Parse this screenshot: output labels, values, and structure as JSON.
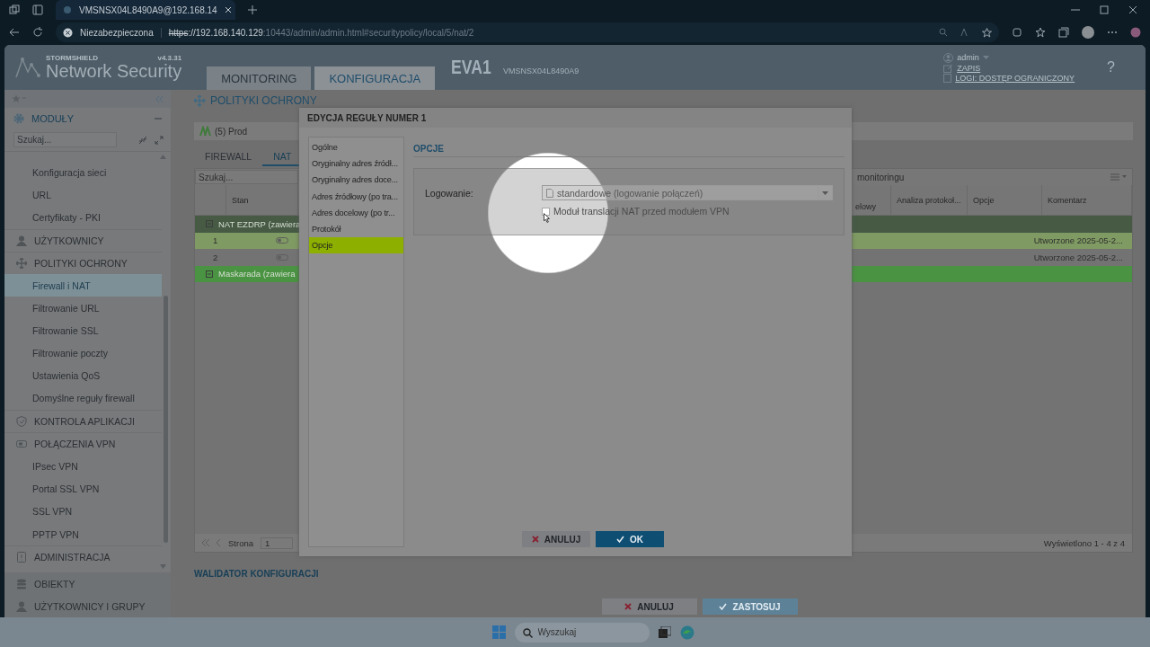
{
  "browser": {
    "tab_title": "VMSNSX04L8490A9@192.168.14",
    "security_label": "Niezabezpieczona",
    "url_scheme": "https",
    "url_host": "://192.168.140.129",
    "url_rest": ":10443/admin/admin.html#securitypolicy/local/5/nat/2"
  },
  "header": {
    "brand": "STORMSHIELD",
    "product": "Network Security",
    "version": "v4.3.31",
    "tabs": [
      {
        "label": "MONITORING",
        "selected": false
      },
      {
        "label": "KONFIGURACJA",
        "selected": true
      }
    ],
    "device_name": "EVA1",
    "device_serial": "VMSNSX04L8490A9",
    "user": "admin",
    "save_link": "ZAPIS",
    "logs_link": "LOGI: DOSTĘP OGRANICZONY",
    "help": "?"
  },
  "sidebar": {
    "modules_label": "MODUŁY",
    "search_placeholder": "Szukaj...",
    "items": [
      {
        "label": "Konfiguracja sieci",
        "kind": "sub",
        "selected": false
      },
      {
        "label": "URL",
        "kind": "sub",
        "selected": false
      },
      {
        "label": "Certyfikaty - PKI",
        "kind": "sub",
        "selected": false
      },
      {
        "label": "UŻYTKOWNICY",
        "kind": "section",
        "selected": false
      },
      {
        "label": "POLITYKI OCHRONY",
        "kind": "section",
        "selected": false
      },
      {
        "label": "Firewall i NAT",
        "kind": "sub",
        "selected": true
      },
      {
        "label": "Filtrowanie URL",
        "kind": "sub",
        "selected": false
      },
      {
        "label": "Filtrowanie SSL",
        "kind": "sub",
        "selected": false
      },
      {
        "label": "Filtrowanie poczty",
        "kind": "sub",
        "selected": false
      },
      {
        "label": "Ustawienia QoS",
        "kind": "sub",
        "selected": false
      },
      {
        "label": "Domyślne reguły firewall",
        "kind": "sub",
        "selected": false
      },
      {
        "label": "KONTROLA APLIKACJI",
        "kind": "section",
        "selected": false
      },
      {
        "label": "POŁĄCZENIA VPN",
        "kind": "section",
        "selected": false
      },
      {
        "label": "IPsec VPN",
        "kind": "sub",
        "selected": false
      },
      {
        "label": "Portal SSL VPN",
        "kind": "sub",
        "selected": false
      },
      {
        "label": "SSL VPN",
        "kind": "sub",
        "selected": false
      },
      {
        "label": "PPTP VPN",
        "kind": "sub",
        "selected": false
      },
      {
        "label": "ADMINISTRACJA",
        "kind": "section",
        "selected": false
      }
    ],
    "bottom": [
      "OBIEKTY",
      "UŻYTKOWNICY I GRUPY"
    ]
  },
  "page": {
    "breadcrumb": "POLITYKI OCHRONY",
    "policy": "(5) Prod",
    "tabs": [
      {
        "label": "FIREWALL",
        "selected": false
      },
      {
        "label": "NAT",
        "selected": true
      }
    ],
    "search_placeholder": "Szukaj...",
    "toolbar_right": "monitoringu",
    "columns_left": [
      "Stan"
    ],
    "columns_right": [
      "elowy",
      "Analiza protokoł...",
      "Opcje",
      "Komentarz"
    ],
    "rows": [
      {
        "kind": "group",
        "label": "NAT EZDRP (zawiera",
        "color": "#465a44"
      },
      {
        "kind": "rule",
        "number": "1",
        "selected": true,
        "comment": "Utworzone 2025-05-2..."
      },
      {
        "kind": "rule",
        "number": "2",
        "selected": false,
        "comment": "Utworzone 2025-05-2..."
      },
      {
        "kind": "group",
        "label": "Maskarada (zawiera",
        "color": "#4a9342"
      }
    ],
    "pager": {
      "label": "Strona",
      "page": "1",
      "summary": "Wyświetlono 1 - 4 z 4"
    },
    "validator": "WALIDATOR KONFIGURACJI",
    "buttons": [
      {
        "label": "ANULUJ",
        "kind": "cancel"
      },
      {
        "label": "ZASTOSUJ",
        "kind": "apply"
      }
    ]
  },
  "dialog": {
    "title": "EDYCJA REGUŁY NUMER 1",
    "nav": [
      {
        "label": "Ogólne",
        "selected": false
      },
      {
        "label": "Oryginalny adres źródł...",
        "selected": false
      },
      {
        "label": "Oryginalny adres doce...",
        "selected": false
      },
      {
        "label": "Adres źródłowy (po tra...",
        "selected": false
      },
      {
        "label": "Adres docelowy (po tr...",
        "selected": false
      },
      {
        "label": "Protokół",
        "selected": false
      },
      {
        "label": "Opcje",
        "selected": true
      }
    ],
    "section_title": "OPCJE",
    "logging_label": "Logowanie:",
    "logging_value": "standardowe (logowanie połączeń)",
    "nat_before_vpn": {
      "label": "Moduł translacji NAT przed modułem VPN",
      "checked": false
    },
    "buttons": [
      {
        "label": "ANULUJ",
        "kind": "cancel"
      },
      {
        "label": "OK",
        "kind": "apply"
      }
    ]
  },
  "taskbar": {
    "search_placeholder": "Wyszukaj"
  }
}
